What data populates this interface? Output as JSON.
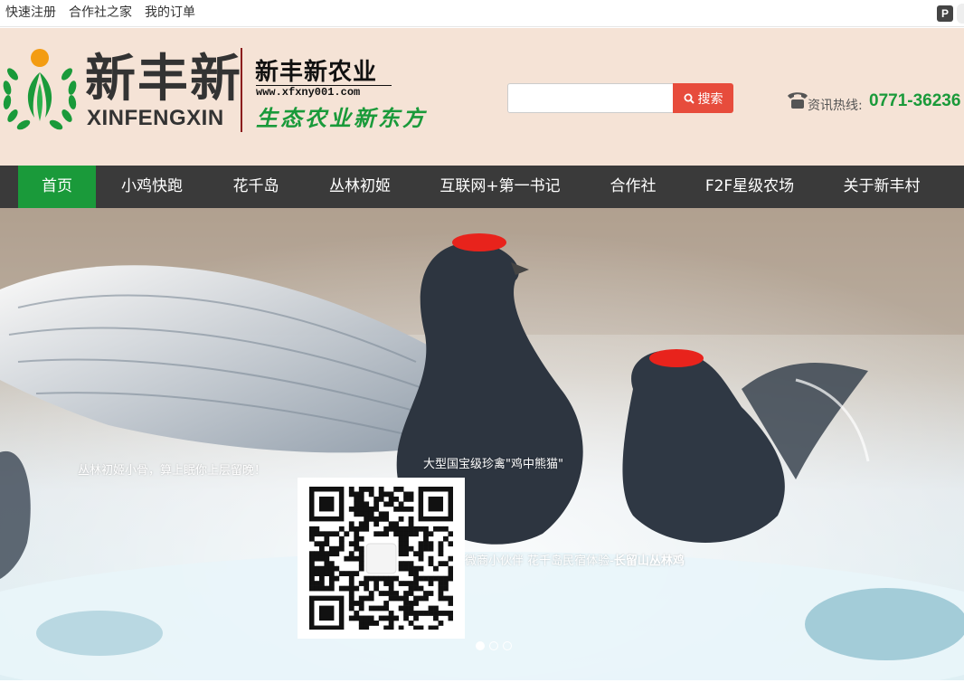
{
  "topbar": {
    "links": [
      "快速注册",
      "合作社之家",
      "我的订单"
    ]
  },
  "header": {
    "logo_cn": "新丰新",
    "logo_en": "XINFENGXIN",
    "brand_title": "新丰新农业",
    "brand_url": "www.xfxny001.com",
    "brand_slogan": "生态农业新东方",
    "search_placeholder": "",
    "search_button": "搜索",
    "hotline_label": "资讯热线:",
    "hotline_number": "0771-36236"
  },
  "nav": {
    "items": [
      "首页",
      "小鸡快跑",
      "花千岛",
      "丛林初姬",
      "互联网+第一书记",
      "合作社",
      "F2F星级农场",
      "关于新丰村"
    ],
    "active_index": 0
  },
  "hero": {
    "caption_1": "丛林初姬小骨，算上眠你上层留晚！",
    "caption_2": "大型国宝级珍禽\"鸡中熊猫\"",
    "caption_3_plain": "微商小伙伴 花千岛民宿体验-",
    "caption_3_bold": "长留山丛林鸡",
    "slide_count": 3,
    "active_slide": 0
  },
  "colors": {
    "header_bg": "#f5e3d6",
    "nav_bg": "#3a3a3a",
    "nav_active": "#1a9a3a",
    "search_button": "#e74c3c",
    "hotline": "#1a9a3a"
  }
}
